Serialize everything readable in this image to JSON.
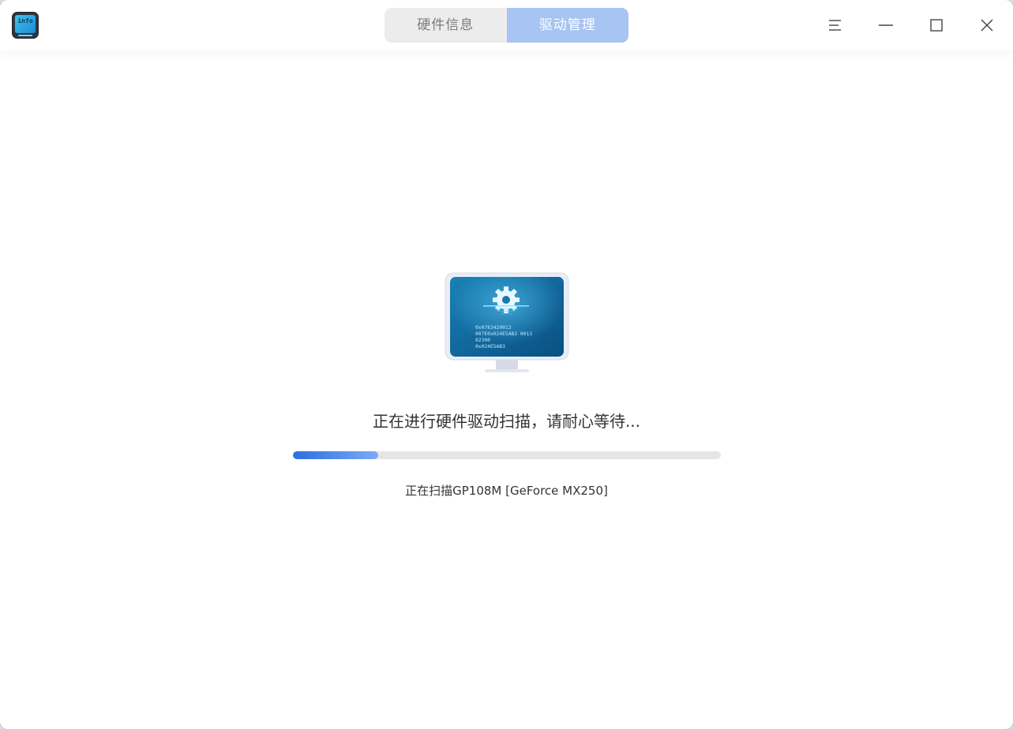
{
  "app": {
    "icon_label": "info",
    "icon": "device-info-app-icon"
  },
  "tabs": [
    {
      "label": "硬件信息",
      "active": false
    },
    {
      "label": "驱动管理",
      "active": true
    }
  ],
  "window_controls": [
    "menu-icon",
    "minimize-icon",
    "maximize-icon",
    "close-icon"
  ],
  "illustration": {
    "icon": "monitor-gear-icon",
    "code_lines": [
      "0x0783420013",
      "007E0x024E5AB3  0013",
      "02300",
      "0x024E5AB3"
    ]
  },
  "status": {
    "title": "正在进行硬件驱动扫描，请耐心等待...",
    "progress_fraction": 0.2,
    "scan_item": "正在扫描GP108M [GeForce MX250]"
  },
  "colors": {
    "accent": "#2b6fe0",
    "tab_active": "#a7c4f2",
    "track": "#e6e6e6"
  }
}
